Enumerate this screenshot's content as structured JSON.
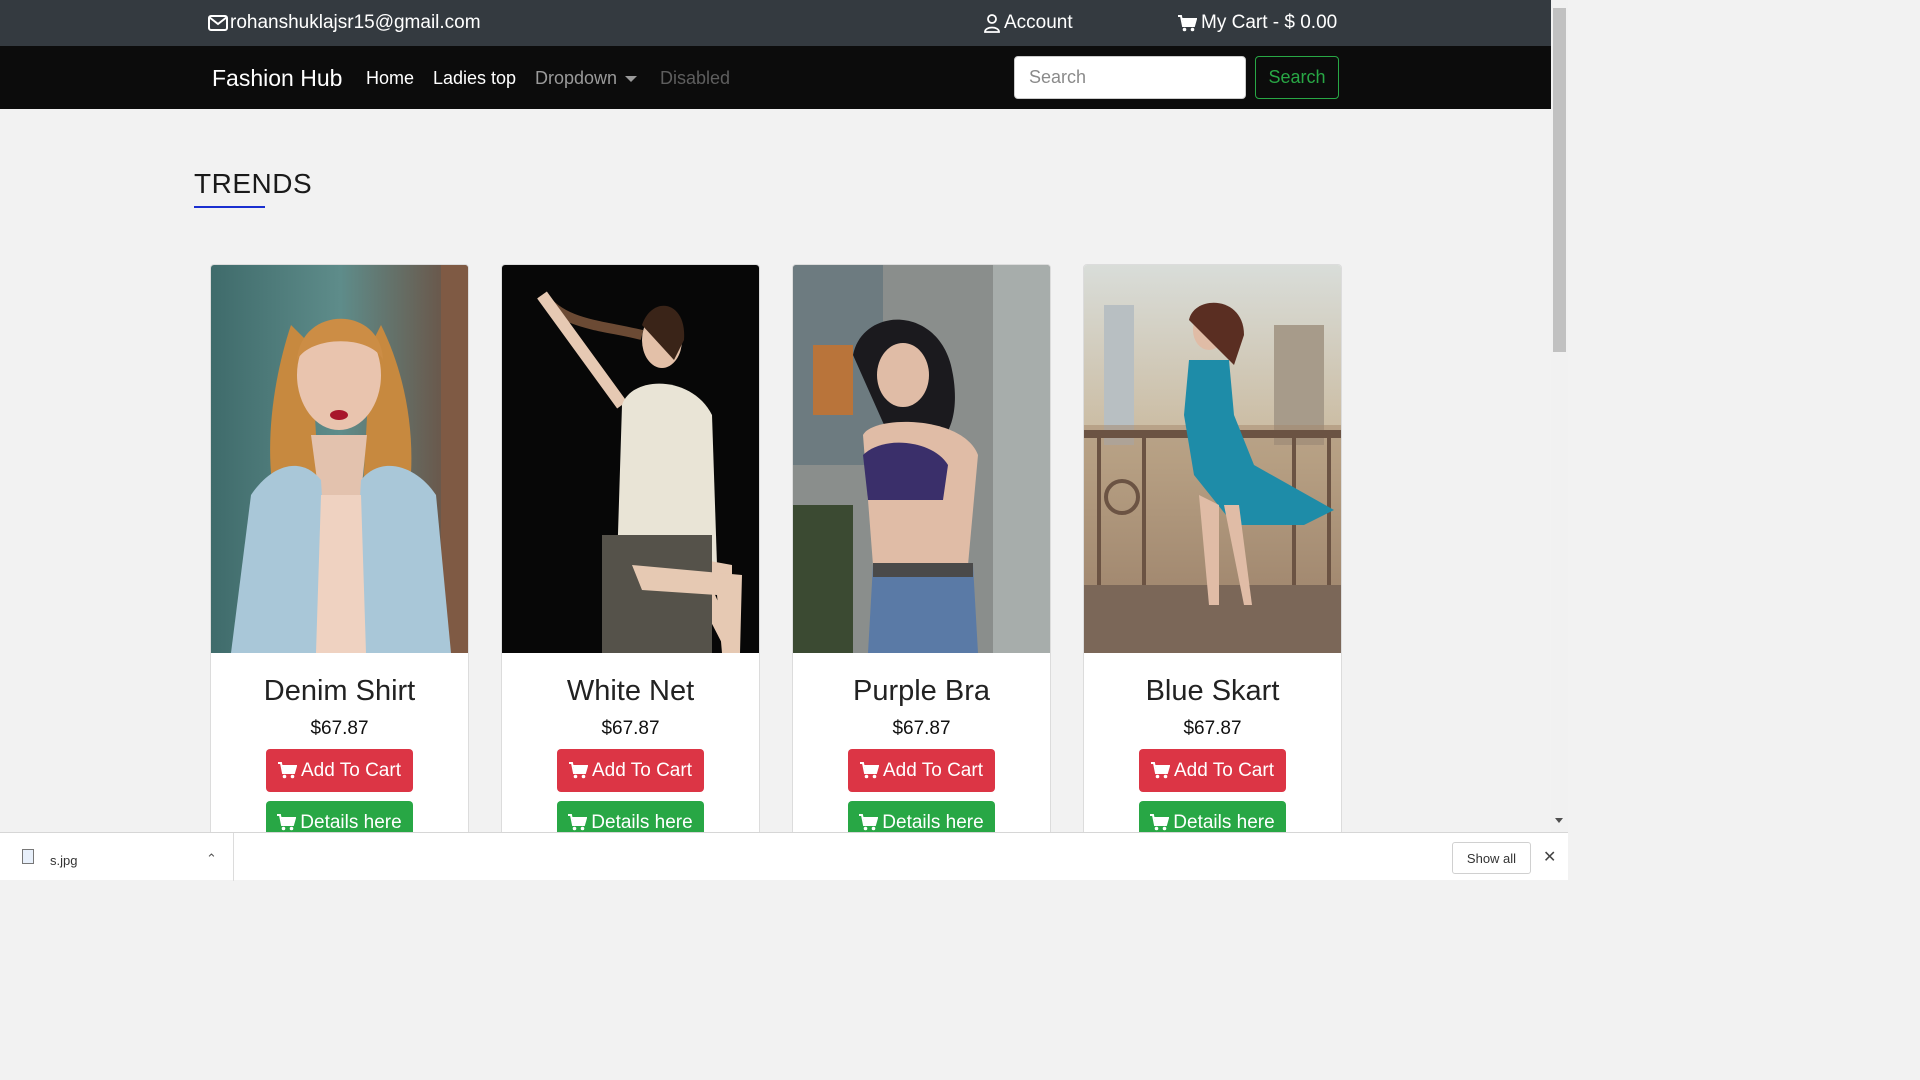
{
  "topbar": {
    "email": "rohanshuklajsr15@gmail.com",
    "account_label": "Account",
    "cart_label": "My Cart - $ 0.00",
    "icons": [
      "envelope-icon",
      "user-icon",
      "cart-icon"
    ]
  },
  "navbar": {
    "brand": "Fashion Hub",
    "links": [
      "Home",
      "Ladies top",
      "Dropdown",
      "Disabled"
    ],
    "search_placeholder": "Search",
    "search_button": "Search"
  },
  "section": {
    "title": "TRENDS",
    "accent_color": "#1a2fd0"
  },
  "products": [
    {
      "name": "Denim Shirt",
      "price": "$67.87",
      "add_label": "Add To Cart",
      "details_label": "Details here"
    },
    {
      "name": "White Net",
      "price": "$67.87",
      "add_label": "Add To Cart",
      "details_label": "Details here"
    },
    {
      "name": "Purple Bra",
      "price": "$67.87",
      "add_label": "Add To Cart",
      "details_label": "Details here"
    },
    {
      "name": "Blue Skart",
      "price": "$67.87",
      "add_label": "Add To Cart",
      "details_label": "Details here"
    }
  ],
  "colors": {
    "add_to_cart": "#dc3545",
    "details": "#28a745",
    "search_outline": "#28a745",
    "topbar": "#343a40",
    "navbar": "#0c0c0c"
  },
  "download_bar": {
    "file_name": "s.jpg",
    "show_all": "Show all"
  }
}
